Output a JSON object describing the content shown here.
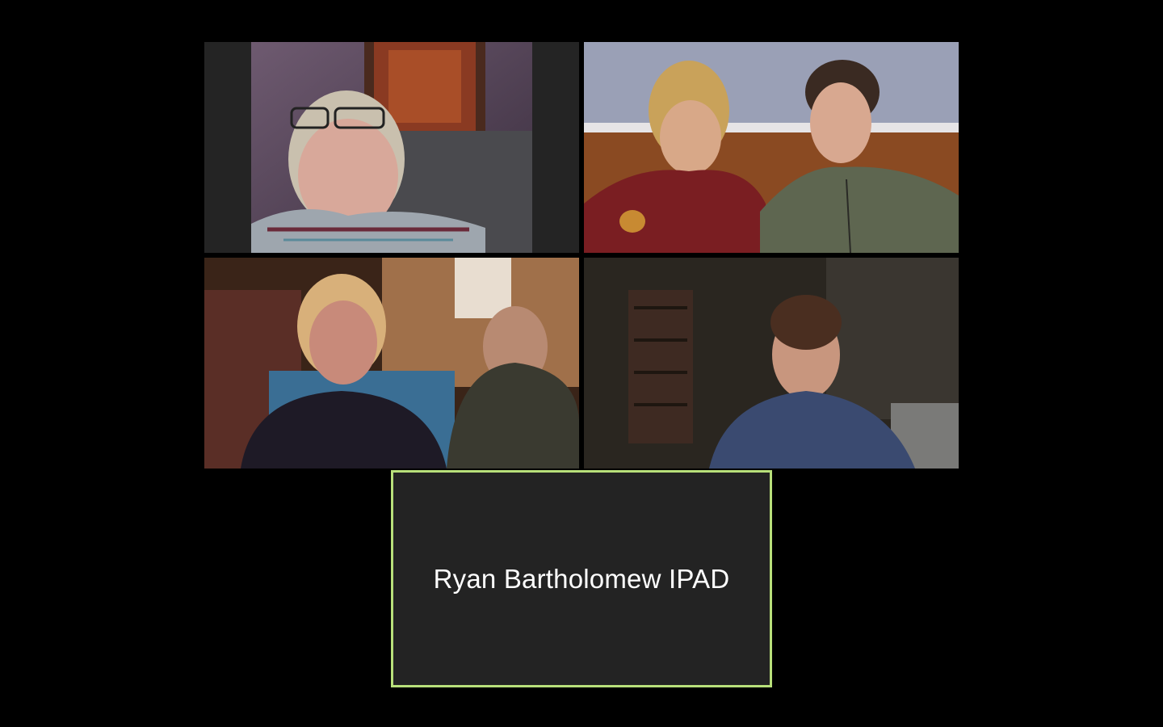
{
  "meeting": {
    "view": "gallery",
    "participants": [
      {
        "name": "",
        "video_on": true
      },
      {
        "name": "",
        "video_on": true
      },
      {
        "name": "",
        "video_on": true
      },
      {
        "name": "",
        "video_on": true
      },
      {
        "name": "Ryan Bartholomew IPAD",
        "video_on": false,
        "active_speaker": true
      }
    ],
    "active_speaker_border_color": "#b8e07a"
  }
}
